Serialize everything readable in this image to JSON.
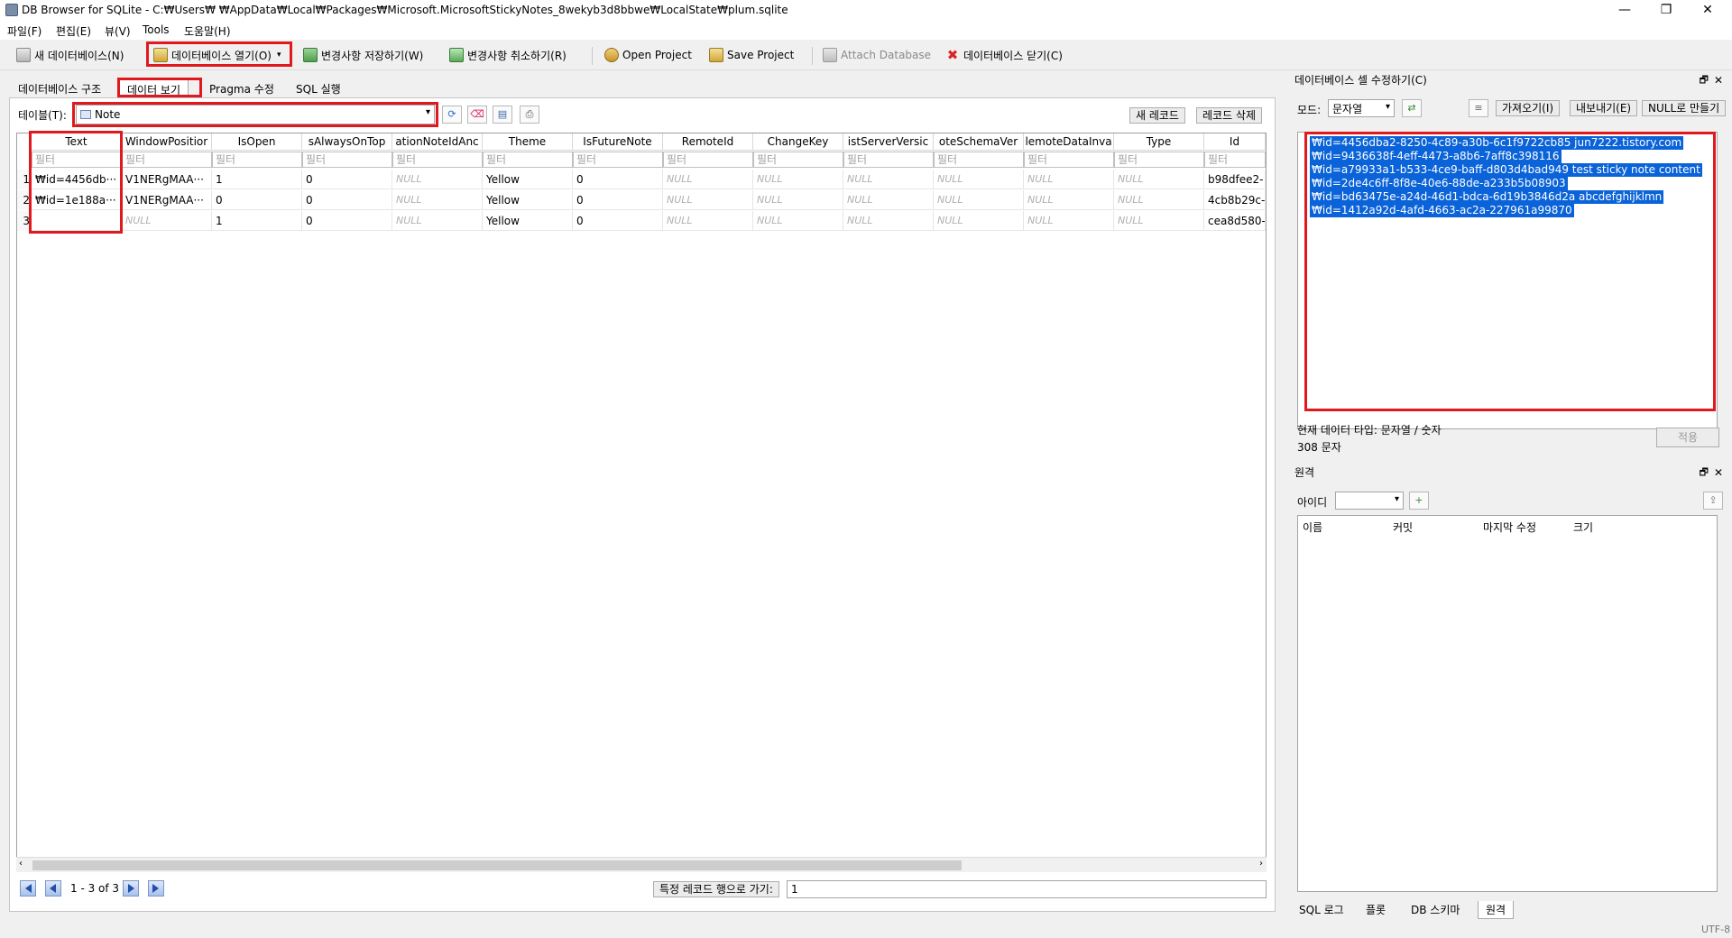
{
  "window": {
    "title": "DB Browser for SQLite - C:₩Users₩          ₩AppData₩Local₩Packages₩Microsoft.MicrosoftStickyNotes_8wekyb3d8bbwe₩LocalState₩plum.sqlite",
    "minimize": "—",
    "maximize": "❐",
    "close": "✕"
  },
  "menu": [
    "파일(F)",
    "편집(E)",
    "뷰(V)",
    "Tools",
    "도움말(H)"
  ],
  "toolbar": {
    "new_db": "새 데이터베이스(N)",
    "open_db": "데이터베이스 열기(O)",
    "write_changes": "변경사항 저장하기(W)",
    "revert_changes": "변경사항 취소하기(R)",
    "open_project": "Open Project",
    "save_project": "Save Project",
    "attach_db": "Attach Database",
    "close_db": "데이터베이스 닫기(C)"
  },
  "tabs": [
    "데이터베이스 구조",
    "데이터 보기",
    "Pragma 수정",
    "SQL 실행"
  ],
  "browse": {
    "table_label": "테이블(T):",
    "table_value": "Note",
    "new_record": "새 레코드",
    "delete_record": "레코드 삭제",
    "columns": [
      "Text",
      "WindowPositior",
      "IsOpen",
      "sAlwaysOnTop",
      "ationNoteIdAnc",
      "Theme",
      "IsFutureNote",
      "RemoteId",
      "ChangeKey",
      "istServerVersic",
      "oteSchemaVer",
      "lemoteDataInva",
      "Type",
      "Id"
    ],
    "filter_placeholder": "필터",
    "rows": [
      {
        "num": "1",
        "cells": [
          "₩id=4456db···",
          "V1NERgMAA···",
          "1",
          "0",
          "NULL",
          "Yellow",
          "0",
          "NULL",
          "NULL",
          "NULL",
          "NULL",
          "NULL",
          "NULL",
          "b98dfee2-"
        ]
      },
      {
        "num": "2",
        "cells": [
          "₩id=1e188a···",
          "V1NERgMAA···",
          "0",
          "0",
          "NULL",
          "Yellow",
          "0",
          "NULL",
          "NULL",
          "NULL",
          "NULL",
          "NULL",
          "NULL",
          "4cb8b29c-"
        ]
      },
      {
        "num": "3",
        "cells": [
          "",
          "NULL",
          "1",
          "0",
          "NULL",
          "Yellow",
          "0",
          "NULL",
          "NULL",
          "NULL",
          "NULL",
          "NULL",
          "NULL",
          "cea8d580-"
        ]
      }
    ],
    "record_count": "1 - 3 of 3",
    "goto_label": "특정 레코드 행으로 가기:",
    "goto_value": "1"
  },
  "edit_cell": {
    "title": "데이터베이스 셀 수정하기(C)",
    "mode_label": "모드:",
    "mode_value": "문자열",
    "import": "가져오기(I)",
    "export": "내보내기(E)",
    "set_null": "NULL로 만들기",
    "lines": [
      "₩id=4456dba2-8250-4c89-a30b-6c1f9722cb85 jun7222.tistory.com",
      "₩id=9436638f-4eff-4473-a8b6-7aff8c398116",
      "₩id=a79933a1-b533-4ce9-baff-d803d4bad949 test sticky note content",
      "₩id=2de4c6ff-8f8e-40e6-88de-a233b5b08903",
      "₩id=bd63475e-a24d-46d1-bdca-6d19b3846d2a abcdefghijklmn",
      "₩id=1412a92d-4afd-4663-ac2a-227961a99870"
    ],
    "type_info": "현재 데이터 타입: 문자열 / 숫자",
    "size_info": "308 문자",
    "apply": "적용"
  },
  "remote": {
    "title": "원격",
    "id_label": "아이디",
    "columns": [
      "이름",
      "커밋",
      "마지막 수정",
      "크기"
    ]
  },
  "bottom_tabs": [
    "SQL 로그",
    "플롯",
    "DB 스키마",
    "원격"
  ],
  "status": {
    "encoding": "UTF-8"
  },
  "float_icon": "🗗",
  "close_icon": "✕"
}
